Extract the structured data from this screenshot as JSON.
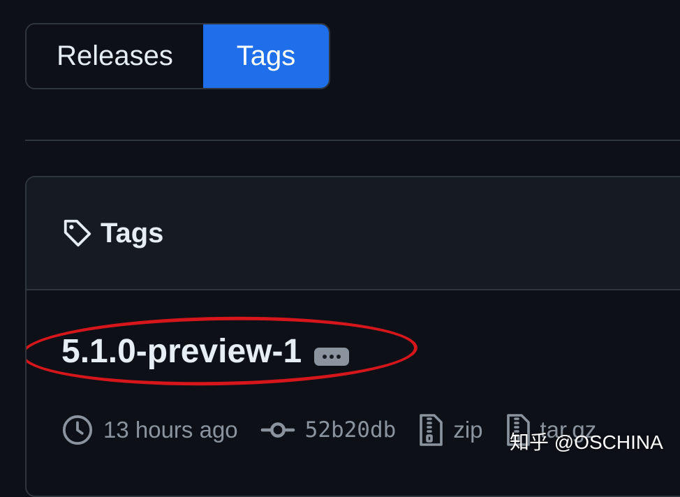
{
  "tabs": {
    "releases_label": "Releases",
    "tags_label": "Tags",
    "active": "Tags"
  },
  "box": {
    "header_title": "Tags",
    "header_icon": "tag-icon"
  },
  "tag": {
    "name": "5.1.0-preview-1",
    "more_icon": "kebab-horizontal-icon",
    "time_ago": "13 hours ago",
    "commit": "52b20db",
    "zip_label": "zip",
    "targz_label": "tar.gz"
  },
  "watermark": "知乎 @OSCHINA",
  "colors": {
    "background": "#0d1117",
    "header_bg": "#161b22",
    "border": "#30363d",
    "accent": "#1f6feb",
    "muted_text": "#8b949e",
    "highlight": "#d7161c"
  }
}
